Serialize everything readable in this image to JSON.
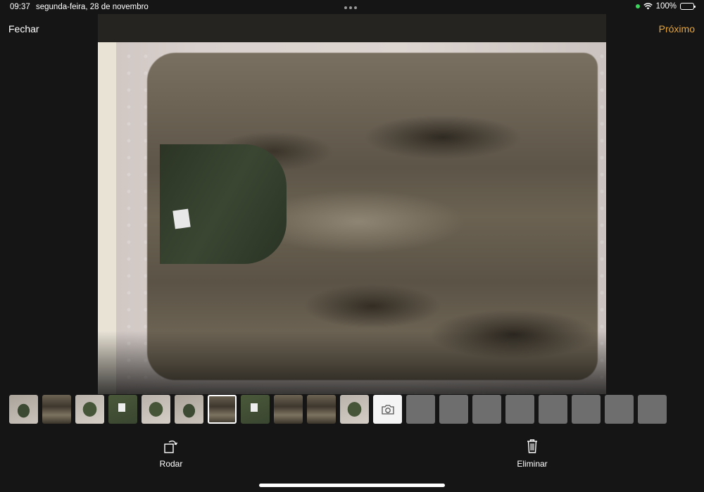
{
  "status_bar": {
    "time": "09:37",
    "date": "segunda-feira, 28 de novembro",
    "battery": "100%",
    "icons": [
      "camera-indicator-icon",
      "wifi-icon",
      "battery-icon"
    ]
  },
  "nav": {
    "close_label": "Fechar",
    "next_label": "Próximo",
    "next_color": "#e8a53a"
  },
  "photo": {
    "tag_text": "",
    "selected_index": 6
  },
  "thumbnails": [
    {
      "kind": "photo",
      "style": "green"
    },
    {
      "kind": "photo",
      "style": "fur"
    },
    {
      "kind": "photo",
      "style": "green2"
    },
    {
      "kind": "photo",
      "style": "label"
    },
    {
      "kind": "photo",
      "style": "green2"
    },
    {
      "kind": "photo",
      "style": "green"
    },
    {
      "kind": "photo",
      "style": "fur"
    },
    {
      "kind": "photo",
      "style": "label"
    },
    {
      "kind": "photo",
      "style": "fur"
    },
    {
      "kind": "photo",
      "style": "fur"
    },
    {
      "kind": "photo",
      "style": "green2"
    },
    {
      "kind": "camera",
      "icon": "camera-icon"
    },
    {
      "kind": "empty"
    },
    {
      "kind": "empty"
    },
    {
      "kind": "empty"
    },
    {
      "kind": "empty"
    },
    {
      "kind": "empty"
    },
    {
      "kind": "empty"
    },
    {
      "kind": "empty"
    },
    {
      "kind": "empty"
    }
  ],
  "actions": {
    "rotate_label": "Rodar",
    "delete_label": "Eliminar"
  }
}
